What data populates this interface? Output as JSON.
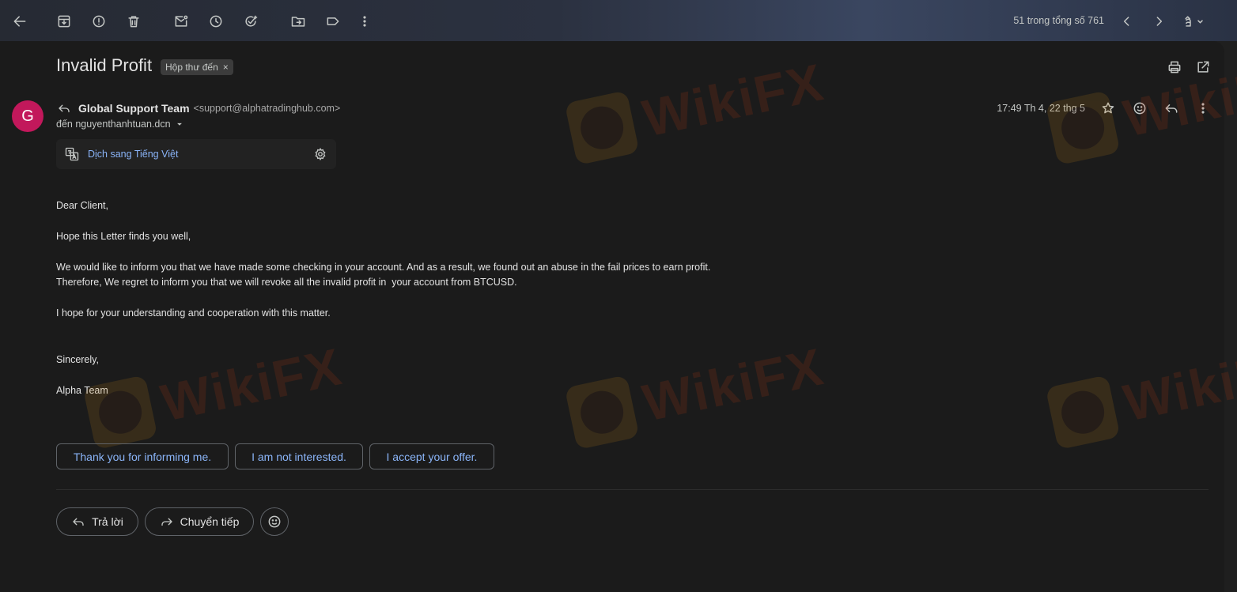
{
  "toolbar": {
    "pager_text": "51 trong tổng số 761"
  },
  "email": {
    "subject": "Invalid Profit",
    "label_chip": "Hộp thư đến",
    "label_remove": "×",
    "avatar_letter": "G",
    "sender_name": "Global Support Team",
    "sender_email": "<support@alphatradinghub.com>",
    "to_line": "đến nguyenthanhtuan.dcn",
    "date": "17:49 Th 4, 22 thg 5",
    "translate_link": "Dịch sang Tiếng Việt",
    "body": {
      "greeting": "Dear Client,",
      "line1": "Hope this Letter finds you well,",
      "line2a": "We would like to inform you that we have made some checking in your account. And as a result, we found out an abuse in the fail prices to earn profit.",
      "line2b": "Therefore, We regret to inform you that we will revoke all the invalid profit in  your account from BTCUSD.",
      "line3": "I hope for your understanding and cooperation with this matter.",
      "closing": "Sincerely,",
      "signature": "Alpha Team"
    }
  },
  "smart_replies": [
    "Thank you for informing me.",
    "I am not interested.",
    "I accept your offer."
  ],
  "actions": {
    "reply": "Trả lời",
    "forward": "Chuyển tiếp"
  },
  "watermark": {
    "text": "WikiFX"
  },
  "colors": {
    "accent_link": "#8ab4f8",
    "avatar_bg": "#c2185b",
    "background": "#1b1b1b"
  }
}
